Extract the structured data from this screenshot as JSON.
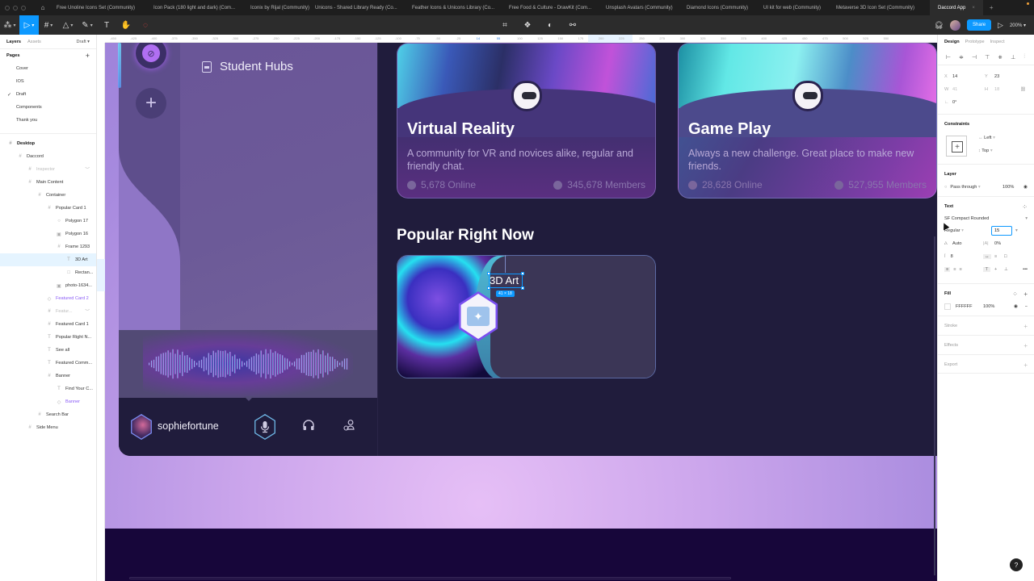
{
  "browser": {
    "tabs": [
      "Free Unoline Icons Set (Community)",
      "Icon Pack (180 light and dark) (Com...",
      "Iconix by Rijal (Community)",
      "Unicons - Shared Library Ready (Co...",
      "Feather Icons & Unicons Library (Co...",
      "Free Food & Culture - DrawKit (Com...",
      "Unsplash Avatars (Community)",
      "Diamond Icons (Community)",
      "UI kit for web (Community)",
      "Metaverse 3D Icon Set (Community)"
    ],
    "active_tab": "Daccord App"
  },
  "toolbar": {
    "share_label": "Share",
    "zoom": "200%",
    "icons": [
      "main-menu-icon",
      "move-tool-icon",
      "frame-tool-icon",
      "shape-tool-icon",
      "pen-tool-icon",
      "text-tool-icon",
      "hand-tool-icon",
      "comment-icon"
    ]
  },
  "left_panel": {
    "tabs": {
      "layers": "Layers",
      "assets": "Assets"
    },
    "page_selector": "Draft",
    "pages_title": "Pages",
    "pages": [
      {
        "label": "Cover",
        "current": false
      },
      {
        "label": "IOS",
        "current": false
      },
      {
        "label": "Draft",
        "current": true
      },
      {
        "label": "Components",
        "current": false
      },
      {
        "label": "Thank you",
        "current": false
      }
    ],
    "layers": [
      {
        "label": "Desktop",
        "depth": 0,
        "icon": "#",
        "style": "bold"
      },
      {
        "label": "Daccord",
        "depth": 1,
        "icon": "#",
        "style": ""
      },
      {
        "label": "Inspector",
        "depth": 2,
        "icon": "#",
        "style": "dim"
      },
      {
        "label": "Main Content",
        "depth": 2,
        "icon": "#",
        "style": ""
      },
      {
        "label": "Container",
        "depth": 3,
        "icon": "#",
        "style": ""
      },
      {
        "label": "Popular Card 1",
        "depth": 4,
        "icon": "#",
        "style": ""
      },
      {
        "label": "Polygon 17",
        "depth": 5,
        "icon": "○",
        "style": ""
      },
      {
        "label": "Polygon 16",
        "depth": 5,
        "icon": "▣",
        "style": ""
      },
      {
        "label": "Frame 1293",
        "depth": 5,
        "icon": "#",
        "style": ""
      },
      {
        "label": "3D Art",
        "depth": 6,
        "icon": "T",
        "style": "sel"
      },
      {
        "label": "Rectan...",
        "depth": 6,
        "icon": "□",
        "style": ""
      },
      {
        "label": "photo-1634...",
        "depth": 5,
        "icon": "▣",
        "style": ""
      },
      {
        "label": "Featured Card 2",
        "depth": 4,
        "icon": "◇",
        "style": "purple"
      },
      {
        "label": "Featur...",
        "depth": 4,
        "icon": "#",
        "style": "dim"
      },
      {
        "label": "Featured Card 1",
        "depth": 4,
        "icon": "#",
        "style": ""
      },
      {
        "label": "Popular Right N...",
        "depth": 4,
        "icon": "T",
        "style": ""
      },
      {
        "label": "See all",
        "depth": 4,
        "icon": "T",
        "style": ""
      },
      {
        "label": "Featured Comm...",
        "depth": 4,
        "icon": "T",
        "style": ""
      },
      {
        "label": "Banner",
        "depth": 4,
        "icon": "#",
        "style": ""
      },
      {
        "label": "Find Your C...",
        "depth": 5,
        "icon": "T",
        "style": ""
      },
      {
        "label": "Banner",
        "depth": 5,
        "icon": "◇",
        "style": "purple"
      },
      {
        "label": "Search Bar",
        "depth": 3,
        "icon": "#",
        "style": ""
      },
      {
        "label": "Side Menu",
        "depth": 2,
        "icon": "#",
        "style": ""
      }
    ]
  },
  "ruler": {
    "top_ticks": [
      "-450",
      "-425",
      "-400",
      "-375",
      "-350",
      "-325",
      "-300",
      "-275",
      "-250",
      "-225",
      "-200",
      "-175",
      "-150",
      "-125",
      "-100",
      "-75",
      "-50",
      "-25",
      "14",
      "55",
      "100",
      "125",
      "150",
      "175",
      "200",
      "225",
      "250",
      "275",
      "300",
      "325",
      "350",
      "375",
      "400",
      "425",
      "450",
      "475",
      "500",
      "525",
      "550"
    ]
  },
  "canvas": {
    "sidebar": {
      "hub_label": "Student Hubs"
    },
    "user": {
      "username": "sophiefortune"
    },
    "cards": [
      {
        "title": "Virtual Reality",
        "description": "A community for VR and novices alike, regular and friendly chat.",
        "online": "5,678 Online",
        "members": "345,678 Members"
      },
      {
        "title": "Game Play",
        "description": "Always a new challenge. Great place to make new friends.",
        "online": "28,628 Online",
        "members": "527,955 Members"
      }
    ],
    "section_title": "Popular Right Now",
    "popular_card": {
      "label": "3D Art",
      "selection_size": "41 × 18"
    }
  },
  "right_panel": {
    "tabs": {
      "design": "Design",
      "prototype": "Prototype",
      "inspect": "Inspect"
    },
    "x": "14",
    "y": "23",
    "w": "41",
    "h": "18",
    "rotation": "0°",
    "constraints_title": "Constraints",
    "constraint_h": "Left",
    "constraint_v": "Top",
    "layer_title": "Layer",
    "blend_mode": "Pass through",
    "layer_opacity": "100%",
    "text_title": "Text",
    "font_family": "SF Compact Rounded",
    "font_weight": "Regular",
    "font_size": "15",
    "line_height": "Auto",
    "letter_spacing": "0%",
    "paragraph_spacing": "8",
    "fill_title": "Fill",
    "fill_hex": "FFFFFF",
    "fill_opacity": "100%",
    "stroke_title": "Stroke",
    "effects_title": "Effects",
    "export_title": "Export"
  }
}
